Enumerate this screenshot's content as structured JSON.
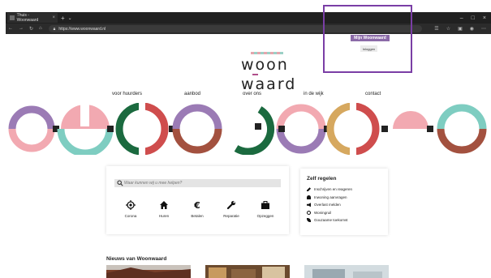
{
  "browser": {
    "tab_title": "Thuis - Woonwaard",
    "new_tab": "+",
    "url": "https://www.woonwaard.nl"
  },
  "logo": {
    "line1": "woon",
    "line2": "waard"
  },
  "nav": [
    "voor huurders",
    "aanbod",
    "over ons",
    "in de wijk",
    "contact"
  ],
  "login": {
    "mijn_label": "Mijn Woonwaard",
    "login_label": "Inloggen"
  },
  "search": {
    "placeholder": "Waar kunnen wij u mee helpen?",
    "quick_links": [
      {
        "label": "Corona",
        "icon": "target-icon"
      },
      {
        "label": "Huren",
        "icon": "house-icon"
      },
      {
        "label": "Betalen",
        "icon": "euro-icon"
      },
      {
        "label": "Reparatie",
        "icon": "wrench-icon"
      },
      {
        "label": "Opzeggen",
        "icon": "briefcase-icon"
      }
    ]
  },
  "zelf": {
    "title": "Zelf regelen",
    "items": [
      {
        "label": "Inschrijven en reageren",
        "icon": "pen-icon"
      },
      {
        "label": "Inwoning aanvragen",
        "icon": "people-icon"
      },
      {
        "label": "Overlast melden",
        "icon": "megaphone-icon"
      },
      {
        "label": "Woningruil",
        "icon": "swap-icon"
      },
      {
        "label": "Gouzaame toekomst",
        "icon": "leaf-icon"
      }
    ]
  },
  "news": {
    "title": "Nieuws van Woonwaard"
  },
  "colors": {
    "purple": "#9b7bb5",
    "pink": "#f2a9b1",
    "teal": "#7ecdc1",
    "green": "#1b6a3f",
    "red": "#cf4d4d",
    "brown": "#a3513f",
    "gold": "#d6a85f",
    "accent": "#8b6aa8"
  }
}
